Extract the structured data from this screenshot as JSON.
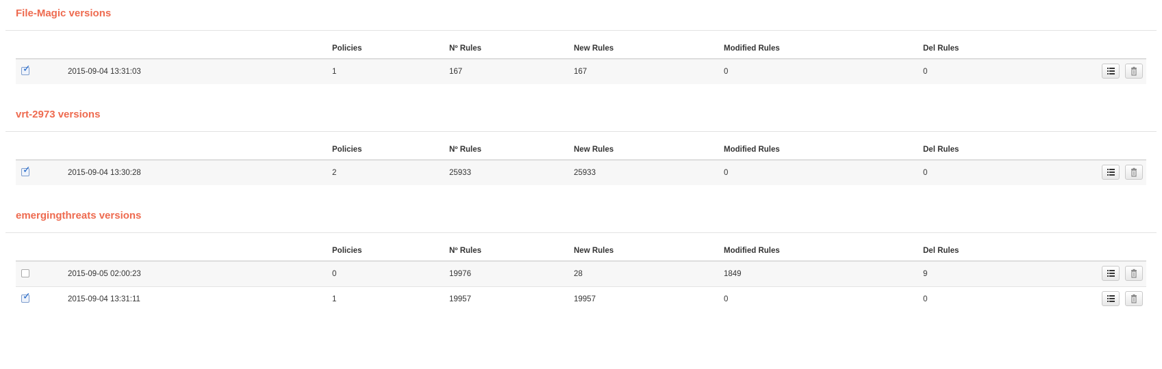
{
  "columns": {
    "policies": "Policies",
    "num_rules": "Nº Rules",
    "new_rules": "New Rules",
    "modified_rules": "Modified Rules",
    "del_rules": "Del Rules"
  },
  "sections": [
    {
      "title": "File-Magic versions",
      "rows": [
        {
          "checked": true,
          "date": "2015-09-04 13:31:03",
          "policies": "1",
          "num_rules": "167",
          "new_rules": "167",
          "modified_rules": "0",
          "del_rules": "0"
        }
      ]
    },
    {
      "title": "vrt-2973 versions",
      "rows": [
        {
          "checked": true,
          "date": "2015-09-04 13:30:28",
          "policies": "2",
          "num_rules": "25933",
          "new_rules": "25933",
          "modified_rules": "0",
          "del_rules": "0"
        }
      ]
    },
    {
      "title": "emergingthreats versions",
      "rows": [
        {
          "checked": false,
          "date": "2015-09-05 02:00:23",
          "policies": "0",
          "num_rules": "19976",
          "new_rules": "28",
          "modified_rules": "1849",
          "del_rules": "9"
        },
        {
          "checked": true,
          "date": "2015-09-04 13:31:11",
          "policies": "1",
          "num_rules": "19957",
          "new_rules": "19957",
          "modified_rules": "0",
          "del_rules": "0"
        }
      ]
    }
  ],
  "icons": {
    "details": "list-icon",
    "delete": "trash-icon"
  },
  "colors": {
    "section_title": "#ee6a4f",
    "check_tick": "#1f66c8"
  }
}
